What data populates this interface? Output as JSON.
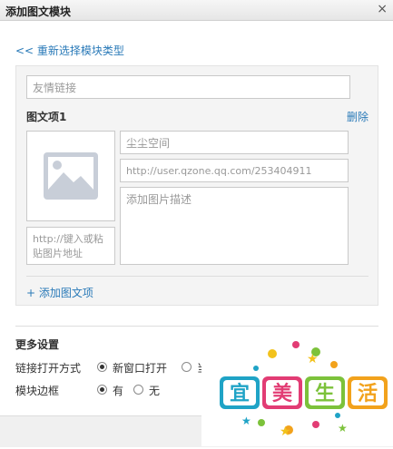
{
  "dialog": {
    "title": "添加图文模块",
    "close_icon": "×"
  },
  "back_link": "<< 重新选择模块类型",
  "module": {
    "name_placeholder": "友情链接",
    "item_title": "图文项1",
    "delete_label": "删除",
    "image_url_placeholder": "http://键入或粘贴图片地址",
    "item_name_placeholder": "尘尘空间",
    "item_link_placeholder": "http://user.qzone.qq.com/253404911",
    "item_desc_placeholder": "添加图片描述",
    "add_item_label": "+ 添加图文项"
  },
  "more_settings": {
    "title": "更多设置",
    "link_open": {
      "label": "链接打开方式",
      "options": [
        {
          "label": "新窗口打开",
          "checked": true
        },
        {
          "label": "当",
          "checked": false
        }
      ]
    },
    "border": {
      "label": "模块边框",
      "options": [
        {
          "label": "有",
          "checked": true
        },
        {
          "label": "无",
          "checked": false
        }
      ]
    }
  },
  "watermark": {
    "chars": [
      "宜",
      "美",
      "生",
      "活"
    ],
    "colors": [
      "#1fa3c6",
      "#e23c74",
      "#7cc23b",
      "#f2a21c"
    ]
  }
}
